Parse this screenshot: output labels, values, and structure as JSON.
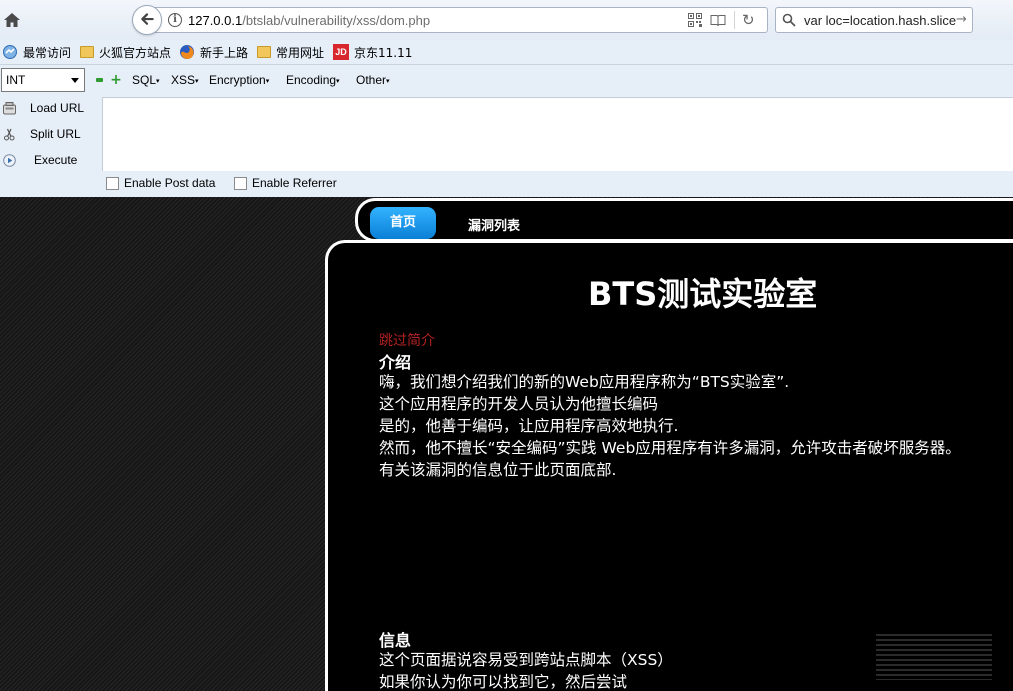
{
  "browser": {
    "url_host": "127.0.0.1",
    "url_path": "/btslab/vulnerability/xss/dom.php",
    "search_value": "var loc=location.hash.slice"
  },
  "bookmarks": [
    {
      "label": "最常访问",
      "icon": "most-visited-icon"
    },
    {
      "label": "火狐官方站点",
      "icon": "folder-icon"
    },
    {
      "label": "新手上路",
      "icon": "firefox-icon"
    },
    {
      "label": "常用网址",
      "icon": "folder-icon"
    },
    {
      "label": "京东11.11",
      "icon": "jd-icon",
      "icon_text": "JD"
    }
  ],
  "hackbar": {
    "select_value": "INT",
    "menus": [
      "SQL",
      "XSS",
      "Encryption",
      "Encoding",
      "Other"
    ],
    "caret": "▾",
    "actions": [
      "Load URL",
      "Split URL",
      "Execute"
    ],
    "textarea_value": "",
    "checkboxes": [
      "Enable Post data",
      "Enable Referrer"
    ]
  },
  "site": {
    "nav_home": "首页",
    "nav_vulns": "漏洞列表",
    "title": "BTS测试实验室",
    "skip_link": "跳过简介",
    "intro_heading": "介绍",
    "intro_lines": [
      "嗨，我们想介绍我们的新的Web应用程序称为“BTS实验室”.",
      "这个应用程序的开发人员认为他擅长编码",
      "是的，他善于编码，让应用程序高效地执行.",
      "然而，他不擅长“安全编码”实践 Web应用程序有许多漏洞，允许攻击者破坏服务器。",
      "有关该漏洞的信息位于此页面底部."
    ],
    "info_heading": "信息",
    "info_lines": [
      "这个页面据说容易受到跨站点脚本（XSS）",
      "如果你认为你可以找到它，然后尝试"
    ]
  },
  "colors": {
    "nav_active": "#1a9bf0",
    "skip_link": "#b22222",
    "hackbar_bg": "#e6eef8"
  }
}
